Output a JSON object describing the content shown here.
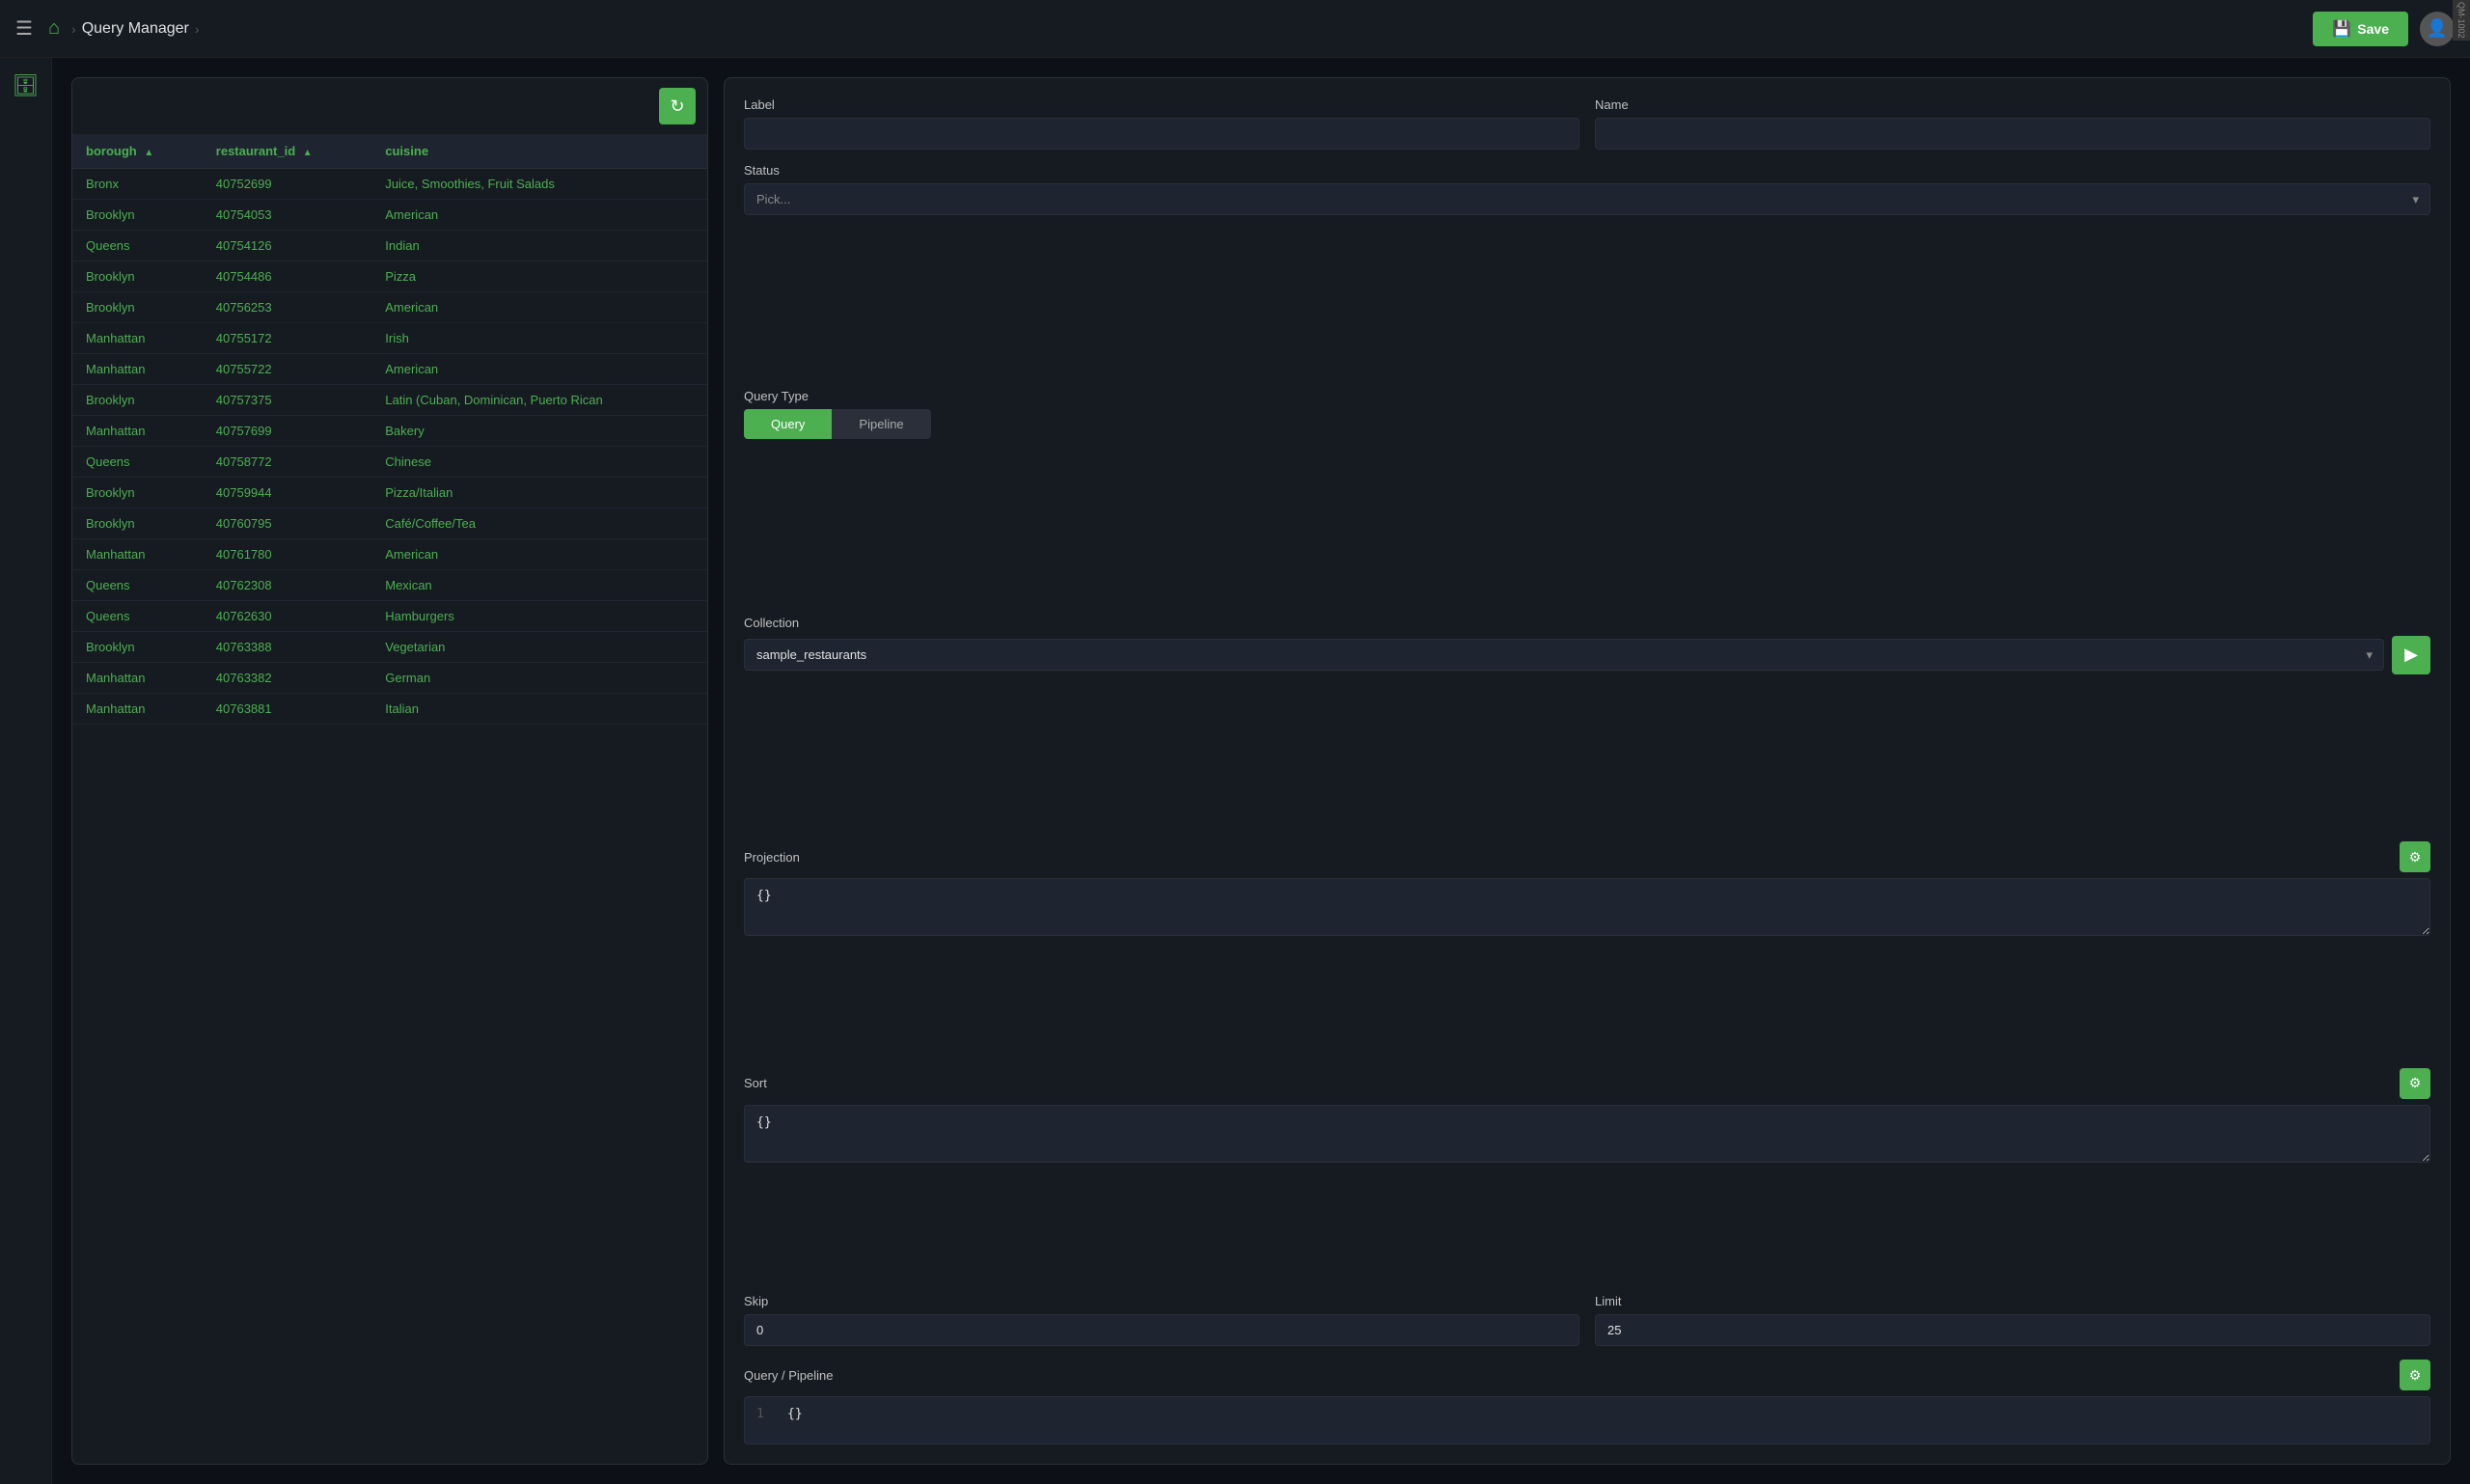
{
  "nav": {
    "title": "Query Manager",
    "save_label": "Save",
    "home_icon": "⌂",
    "hamburger_icon": "☰",
    "chevron": "›",
    "save_icon": "💾",
    "user_icon": "👤"
  },
  "sidebar": {
    "db_icon": "🗄"
  },
  "table": {
    "refresh_icon": "↻",
    "columns": [
      {
        "key": "borough",
        "label": "borough",
        "sort": "asc"
      },
      {
        "key": "restaurant_id",
        "label": "restaurant_id",
        "sort": "asc"
      },
      {
        "key": "cuisine",
        "label": "cuisine"
      }
    ],
    "rows": [
      {
        "borough": "Bronx",
        "restaurant_id": "40752699",
        "cuisine": "Juice, Smoothies, Fruit Salads"
      },
      {
        "borough": "Brooklyn",
        "restaurant_id": "40754053",
        "cuisine": "American"
      },
      {
        "borough": "Queens",
        "restaurant_id": "40754126",
        "cuisine": "Indian"
      },
      {
        "borough": "Brooklyn",
        "restaurant_id": "40754486",
        "cuisine": "Pizza"
      },
      {
        "borough": "Brooklyn",
        "restaurant_id": "40756253",
        "cuisine": "American"
      },
      {
        "borough": "Manhattan",
        "restaurant_id": "40755172",
        "cuisine": "Irish"
      },
      {
        "borough": "Manhattan",
        "restaurant_id": "40755722",
        "cuisine": "American"
      },
      {
        "borough": "Brooklyn",
        "restaurant_id": "40757375",
        "cuisine": "Latin (Cuban, Dominican, Puerto Rican"
      },
      {
        "borough": "Manhattan",
        "restaurant_id": "40757699",
        "cuisine": "Bakery"
      },
      {
        "borough": "Queens",
        "restaurant_id": "40758772",
        "cuisine": "Chinese"
      },
      {
        "borough": "Brooklyn",
        "restaurant_id": "40759944",
        "cuisine": "Pizza/Italian"
      },
      {
        "borough": "Brooklyn",
        "restaurant_id": "40760795",
        "cuisine": "Café/Coffee/Tea"
      },
      {
        "borough": "Manhattan",
        "restaurant_id": "40761780",
        "cuisine": "American"
      },
      {
        "borough": "Queens",
        "restaurant_id": "40762308",
        "cuisine": "Mexican"
      },
      {
        "borough": "Queens",
        "restaurant_id": "40762630",
        "cuisine": "Hamburgers"
      },
      {
        "borough": "Brooklyn",
        "restaurant_id": "40763388",
        "cuisine": "Vegetarian"
      },
      {
        "borough": "Manhattan",
        "restaurant_id": "40763382",
        "cuisine": "German"
      },
      {
        "borough": "Manhattan",
        "restaurant_id": "40763881",
        "cuisine": "Italian"
      }
    ]
  },
  "form": {
    "label_label": "Label",
    "name_label": "Name",
    "status_label": "Status",
    "status_placeholder": "Pick...",
    "query_type_label": "Query Type",
    "query_btn": "Query",
    "pipeline_btn": "Pipeline",
    "collection_label": "Collection",
    "collection_value": "sample_restaurants",
    "projection_label": "Projection",
    "projection_value": "{}",
    "sort_label": "Sort",
    "sort_value": "{}",
    "skip_label": "Skip",
    "skip_value": "0",
    "limit_label": "Limit",
    "limit_value": "25",
    "query_pipeline_label": "Query / Pipeline",
    "query_line_number": "1",
    "query_content": "{}",
    "settings_icon": "⚙",
    "run_icon": "▶"
  }
}
